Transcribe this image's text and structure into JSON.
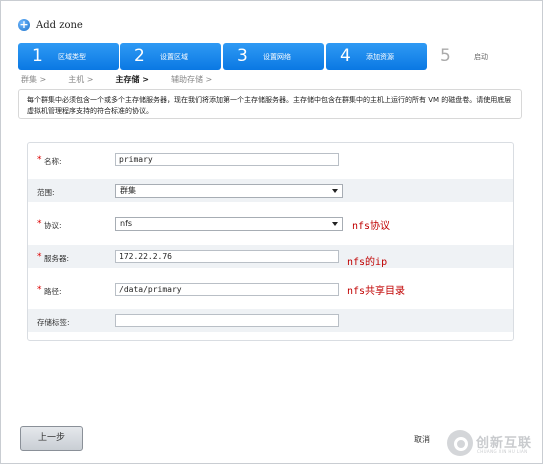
{
  "header": {
    "title": "Add zone"
  },
  "steps": [
    {
      "num": "1",
      "label": "区域类型"
    },
    {
      "num": "2",
      "label": "设置区域"
    },
    {
      "num": "3",
      "label": "设置网络"
    },
    {
      "num": "4",
      "label": "添加资源"
    },
    {
      "num": "5",
      "label": "启动"
    }
  ],
  "subtabs": [
    "群集 >",
    "主机 >",
    "主存储 >",
    "辅助存储 >"
  ],
  "notice": "每个群集中必须包含一个或多个主存储服务器，现在我们将添加第一个主存储服务器。主存储中包含在群集中的主机上运行的所有 VM 的磁盘卷。请使用底层虚拟机管理程序支持的符合标准的协议。",
  "form": {
    "name": {
      "label": "名称:",
      "value": "primary"
    },
    "scope": {
      "label": "范围:",
      "value": "群集"
    },
    "protocol": {
      "label": "协议:",
      "value": "nfs",
      "note": "nfs协议"
    },
    "server": {
      "label": "服务器:",
      "value": "172.22.2.76",
      "note": "nfs的ip"
    },
    "path": {
      "label": "路径:",
      "value": "/data/primary",
      "note": "nfs共享目录"
    },
    "tags": {
      "label": "存储标签:",
      "value": ""
    }
  },
  "footer": {
    "prev_label": "上一步",
    "cancel_label": "取消"
  },
  "watermark": {
    "text": "创新互联",
    "sub": "CHUANG XIN HU LIAN"
  }
}
